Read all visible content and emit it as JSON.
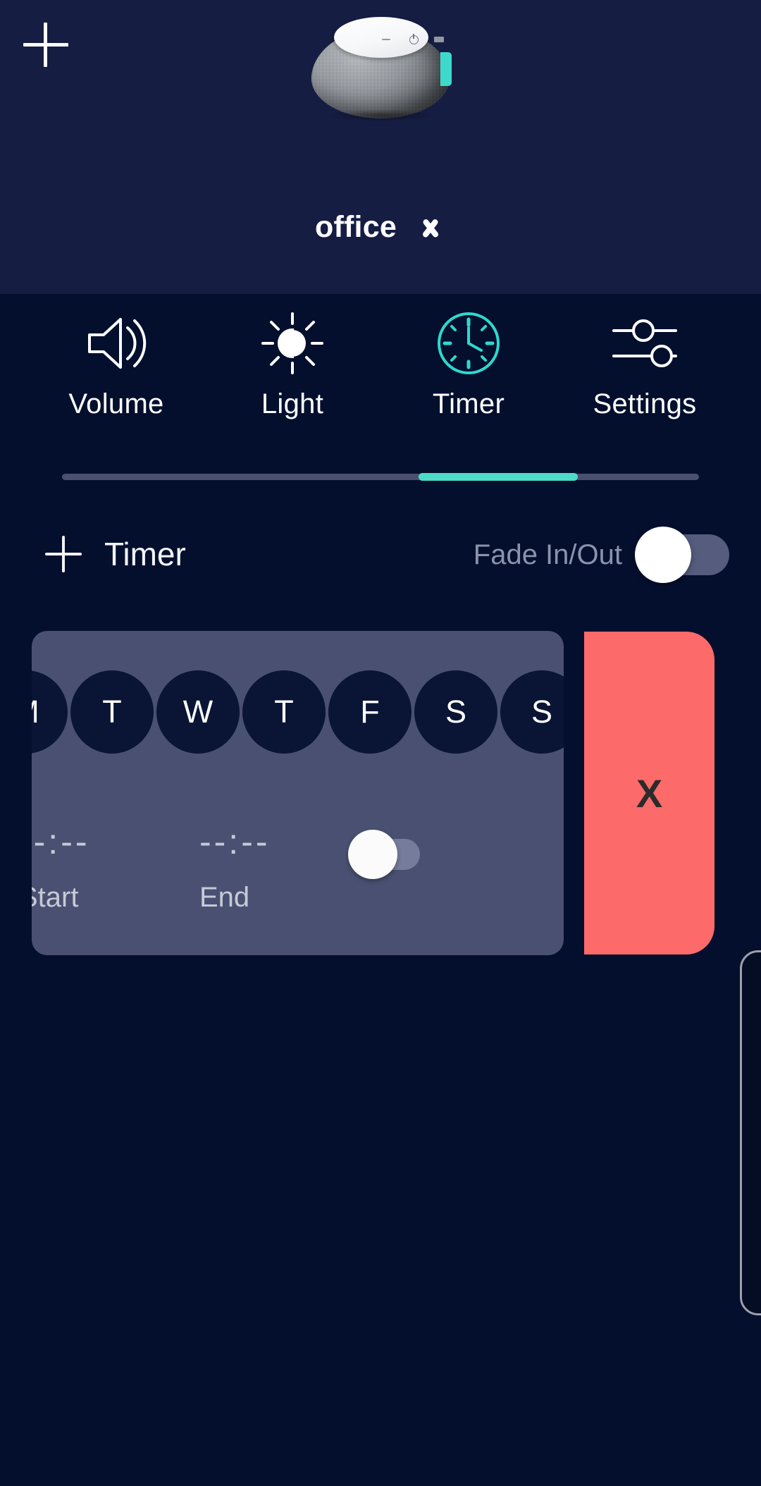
{
  "theme": {
    "background": "#040f2e",
    "header_background": "#151d43",
    "accent": "#4ddbc8",
    "card_background": "#4a5071",
    "delete_background": "#fc6a6a",
    "muted_text": "#8b93ac"
  },
  "header": {
    "add_icon": "plus-icon",
    "device_image": "fabric-smart-speaker",
    "room_name": "office",
    "room_chevron_icon": "chevron-down-icon"
  },
  "tabs": [
    {
      "label": "Volume",
      "icon": "volume-icon",
      "active": false
    },
    {
      "label": "Light",
      "icon": "brightness-icon",
      "active": false
    },
    {
      "label": "Timer",
      "icon": "clock-icon",
      "active": true
    },
    {
      "label": "Settings",
      "icon": "sliders-icon",
      "active": false
    }
  ],
  "controls": {
    "add_timer_label": "Timer",
    "add_timer_icon": "plus-icon",
    "fade_label": "Fade In/Out",
    "fade_state": "off"
  },
  "timer_card": {
    "days": [
      {
        "letter": "M",
        "selected": false
      },
      {
        "letter": "T",
        "selected": false
      },
      {
        "letter": "W",
        "selected": false
      },
      {
        "letter": "T",
        "selected": false
      },
      {
        "letter": "F",
        "selected": false
      },
      {
        "letter": "S",
        "selected": false
      },
      {
        "letter": "S",
        "selected": false
      }
    ],
    "start_value": "--:--",
    "start_caption": "Start",
    "end_value": "--:--",
    "end_caption": "End",
    "enabled_state": "off",
    "delete_label": "X"
  }
}
